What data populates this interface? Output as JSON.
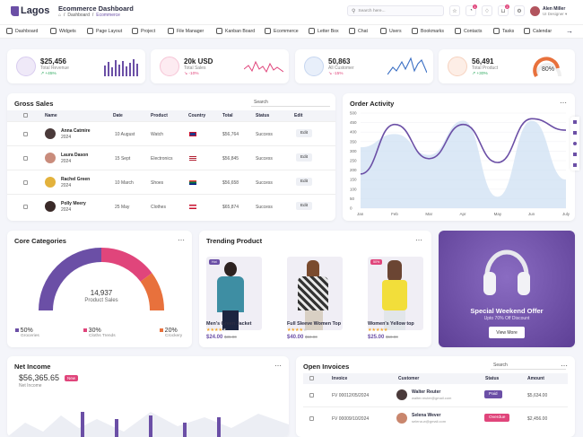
{
  "brand": {
    "logo": "Lagos"
  },
  "header": {
    "title": "Ecommerce Dashboard",
    "crumb1": "Dashboard",
    "crumb2": "Ecommerce",
    "search_placeholder": "Search here...",
    "user_name": "Alen Miller",
    "user_role": "UI Designer",
    "badge_bell": "1",
    "badge_cart": "2"
  },
  "nav": [
    "Dashboard",
    "Widgets",
    "Page Layout",
    "Project",
    "File Manager",
    "Kanban Board",
    "Ecommerce",
    "Letter Box",
    "Chat",
    "Users",
    "Bookmarks",
    "Contacts",
    "Tasks",
    "Calendar"
  ],
  "stats": [
    {
      "value": "$25,456",
      "label": "Total Revenue",
      "change": "↗ +45%",
      "color": "#6b4fa6"
    },
    {
      "value": "20k USD",
      "label": "Total Sales",
      "change": "↘ -10%",
      "color": "#e0457b"
    },
    {
      "value": "50,863",
      "label": "All Customer",
      "change": "↘ -15%",
      "color": "#3b6fc4"
    },
    {
      "value": "56,491",
      "label": "Total Product",
      "change": "↗ +30%",
      "color": "#e8713c"
    }
  ],
  "total_product_gauge": {
    "label": "80%",
    "fraction": 0.8
  },
  "gross_sales": {
    "title": "Gross Sales",
    "search_label": "Search",
    "columns": [
      "Name",
      "Date",
      "Product",
      "Country",
      "Total",
      "Status",
      "Edit"
    ],
    "rows": [
      {
        "name": "Anna Catmire",
        "year": "2024",
        "date": "10 August",
        "product": "Watch",
        "total": "$56,764",
        "status": "Success",
        "edit": "Edit"
      },
      {
        "name": "Laura Dason",
        "year": "2024",
        "date": "15 Sept",
        "product": "Electronics",
        "total": "$56,845",
        "status": "Success",
        "edit": "Edit"
      },
      {
        "name": "Rachel Green",
        "year": "2024",
        "date": "10 March",
        "product": "Shoes",
        "total": "$56,658",
        "status": "Success",
        "edit": "Edit"
      },
      {
        "name": "Polly Meery",
        "year": "2024",
        "date": "25 May",
        "product": "Clothes",
        "total": "$65,874",
        "status": "Success",
        "edit": "Edit"
      }
    ]
  },
  "order_activity": {
    "title": "Order Activity"
  },
  "chart_data": {
    "type": "area",
    "title": "Order Activity",
    "x": [
      "Jan",
      "Feb",
      "Mar",
      "Apr",
      "May",
      "Jun",
      "July"
    ],
    "yticks": [
      "0",
      "50",
      "100",
      "150",
      "200",
      "250",
      "300",
      "350",
      "400",
      "450",
      "500"
    ],
    "ylim": [
      0,
      500
    ],
    "series": [
      {
        "values": [
          180,
          440,
          260,
          440,
          240,
          470,
          410
        ],
        "color": "#6b4fa6"
      },
      {
        "values": [
          320,
          390,
          280,
          460,
          60,
          460,
          150
        ],
        "color": "#cfe0f3"
      }
    ]
  },
  "core_categories": {
    "title": "Core Categories",
    "center_value": "14,937",
    "center_label": "Product Sales",
    "items": [
      {
        "pct": "50%",
        "label": "Groceries",
        "color": "#6b4fa6"
      },
      {
        "pct": "30%",
        "label": "Cloths Trends",
        "color": "#e0457b"
      },
      {
        "pct": "20%",
        "label": "Crockery",
        "color": "#e8713c"
      }
    ]
  },
  "trending": {
    "title": "Trending Product",
    "products": [
      {
        "name": "Men's Green Jacket",
        "price": "$24.00",
        "old": "$35.00",
        "badge": "Hot"
      },
      {
        "name": "Full Sleeve Women Top",
        "price": "$40.00",
        "old": "$50.00",
        "badge": ""
      },
      {
        "name": "Women's Yellow top",
        "price": "$25.00",
        "old": "$50.00",
        "badge": "50%"
      }
    ]
  },
  "promo": {
    "title": "Special Weekend Offer",
    "subtitle": "Upto 70% Off Discount",
    "button": "View More"
  },
  "net_income": {
    "title": "Net Income",
    "value": "$56,365.65",
    "label": "Net Income",
    "badge": "New"
  },
  "open_invoices": {
    "title": "Open Invoices",
    "search_label": "Search",
    "columns": [
      "Invoice",
      "Customer",
      "Status",
      "Amount"
    ],
    "rows": [
      {
        "invoice": "FV 00012/05/2024",
        "name": "Walter Reuter",
        "email": "walter.reuter@gmail.com",
        "status": "Paid",
        "amount": "$5,634.00",
        "color": "#6b4fa6"
      },
      {
        "invoice": "FV 00009/10/2024",
        "name": "Selena Wever",
        "email": "selena.w@gmail.com",
        "status": "Overdue",
        "amount": "$2,456.00",
        "color": "#e0457b"
      }
    ]
  }
}
